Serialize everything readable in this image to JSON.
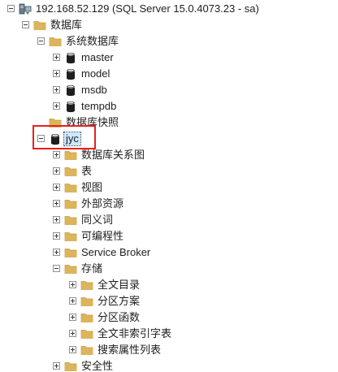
{
  "tree": {
    "server": {
      "label": "192.168.52.129 (SQL Server 15.0.4073.23 - sa)",
      "icon": "server-icon"
    },
    "databases_folder": "数据库",
    "system_databases_folder": "系统数据库",
    "system_databases": [
      "master",
      "model",
      "msdb",
      "tempdb"
    ],
    "snapshots_folder": "数据库快照",
    "user_database": {
      "label": "jyc",
      "selected": true,
      "children": [
        "数据库关系图",
        "表",
        "视图",
        "外部资源",
        "同义词",
        "可编程性",
        "Service Broker",
        "存储"
      ],
      "storage_children": [
        "全文目录",
        "分区方案",
        "分区函数",
        "全文非索引字表",
        "搜索属性列表"
      ],
      "after_storage": "安全性"
    }
  },
  "colors": {
    "folder": "#dcb55a",
    "folder_dark": "#c49a3f",
    "database": "#1e1e1e",
    "selection": "#cce8ff",
    "highlight_box": "#e8201c"
  }
}
